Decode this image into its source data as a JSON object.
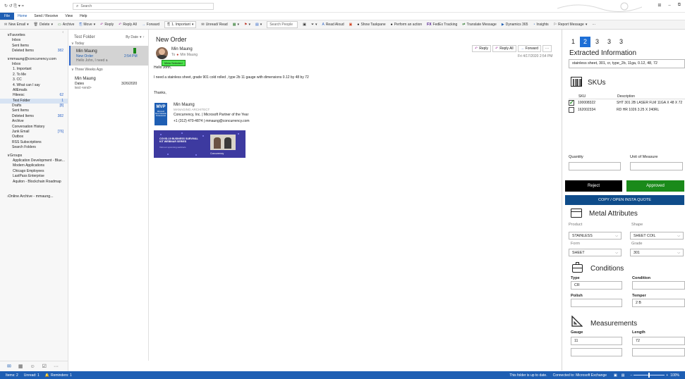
{
  "titlebar": {
    "search_placeholder": "Search",
    "qat": "↻ ↺ ⎘ ▾ ="
  },
  "menubar": {
    "tabs": [
      "File",
      "Home",
      "Send / Receive",
      "View",
      "Help"
    ],
    "active": "Home"
  },
  "toolbar": {
    "new_email": "New Email",
    "delete": "Delete",
    "archive": "Archive",
    "move": "Move",
    "reply": "Reply",
    "reply_all": "Reply All",
    "forward": "Forward",
    "category_tag": "1. Important",
    "unread_read": "Unread/ Read",
    "search_people": "Search People",
    "read_aloud": "Read Aloud",
    "show_taskpane": "Show Taskpane",
    "perform_action": "Perform an action",
    "fedex": "FedEx Tracking",
    "translate": "Translate Message",
    "dynamics": "Dynamics 365",
    "insights": "Insights",
    "report": "Report Message",
    "more": "···"
  },
  "leftnav": {
    "favorites_header": "Favorites",
    "favorites": [
      {
        "label": "Inbox",
        "count": ""
      },
      {
        "label": "Sent Items",
        "count": ""
      },
      {
        "label": "Deleted Items",
        "count": "382"
      }
    ],
    "account": "mmaung@concurrency.com",
    "folders": [
      {
        "label": "Inbox",
        "count": "",
        "level": 1
      },
      {
        "label": "1. Important",
        "count": "",
        "level": 2
      },
      {
        "label": "2. To Me",
        "count": "",
        "level": 2
      },
      {
        "label": "3. CC",
        "count": "",
        "level": 2
      },
      {
        "label": "4. What can I say",
        "count": "",
        "level": 2
      },
      {
        "label": "AllEmails",
        "count": "",
        "level": 2
      },
      {
        "label": "Hiteesc",
        "count": "62",
        "level": 2
      },
      {
        "label": "Test Folder",
        "count": "1",
        "level": 2,
        "selected": true
      },
      {
        "label": "Drafts",
        "count": "[8]",
        "level": 1
      },
      {
        "label": "Sent Items",
        "count": "",
        "level": 1
      },
      {
        "label": "Deleted Items",
        "count": "382",
        "level": 1
      },
      {
        "label": "Archive",
        "count": "",
        "level": 1
      },
      {
        "label": "Conversation History",
        "count": "",
        "level": 1
      },
      {
        "label": "Junk Email",
        "count": "[76]",
        "level": 1
      },
      {
        "label": "Outbox",
        "count": "",
        "level": 1
      },
      {
        "label": "RSS Subscriptions",
        "count": "",
        "level": 1
      },
      {
        "label": "Search Folders",
        "count": "",
        "level": 1
      }
    ],
    "groups_header": "Groups",
    "groups": [
      "Application Development - Blue...",
      "Modern Applications",
      "Chicago Employees",
      "LastPass Enterprise",
      "Aquiton - Blockchain Roadmap"
    ],
    "online_archive": "Online Archive - mmaung..."
  },
  "msglist": {
    "folder_title": "Test Folder",
    "sort_label": "By Date",
    "sort_arrow": "↑",
    "group_today": "Today",
    "group_older": "Three Weeks Ago",
    "messages": [
      {
        "from": "Min Maung",
        "subject": "New Order",
        "time": "2:54 PM",
        "preview": "Hello John,   I need a",
        "selected": true
      },
      {
        "from": "Min Maung",
        "subject": "Dates",
        "time": "3/26/2020",
        "preview": "test <end>",
        "selected": false
      }
    ]
  },
  "reading": {
    "subject": "New Order",
    "sender": "Min Maung",
    "to_label": "To",
    "to_name": "Min Maung",
    "date": "Fri 4/17/2020 2:54 PM",
    "actions": {
      "reply": "Reply",
      "reply_all": "Reply All",
      "forward": "Forward",
      "more": "···"
    },
    "tag": "Meta Selected",
    "body_greeting": "Hello John,",
    "body_text": "I need a stainless sheet, grade 901 cold rolled , type 2b 11 gauge with dimensions 0.12 by 48 by 72",
    "body_thanks": "Thanks,",
    "sig_name": "Min Maung",
    "sig_title": "MANAGING ARCHITECT",
    "sig_company": "Concurrency, Inc.  |  Microsoft Partner of the Year",
    "sig_contact": "+1 (312) 470-4874  |  mmaung@concurrency.com",
    "mvp_badge": "MVP",
    "mvp_sub": "Microsoft Most Valuable Professional",
    "banner_title": "COVID-19 BUSINESS SURVIVAL KIT WEBINAR SERIES",
    "banner_sub": "Visit our upcoming webinars",
    "banner_logo": "Concurrency"
  },
  "rpane": {
    "tabs": [
      "1",
      "2",
      "3",
      "3",
      "3"
    ],
    "active_tab": 1,
    "extracted_title": "Extracted Information",
    "extracted_text": "stainless sheet, 301, cr, type_2b, 11ga, 0.12, 48, 72",
    "skus_title": "SKUs",
    "sku_col": "SKU",
    "desc_col": "Description",
    "skus": [
      {
        "sku": "100008322",
        "desc": "SHT 301 2B LASER FLM 11GA X 48 X 72",
        "checked": true
      },
      {
        "sku": "162002334",
        "desc": "RD HR 1026 3.25 X 240RL",
        "checked": false
      }
    ],
    "quantity_label": "Quantity",
    "uom_label": "Unit of Measure",
    "quantity_value": "",
    "uom_value": "",
    "reject_label": "Reject",
    "approved_label": "Approved",
    "copy_label": "COPY / OPEN INSTA QUOTE",
    "metal_title": "Metal Attributes",
    "product_label": "Product",
    "product_value": "STAINLESS",
    "shape_label": "Shape",
    "shape_value": "SHEET COIL",
    "form_label": "Form",
    "form_value": "SHEET",
    "grade_label": "Grade",
    "grade_value": "301",
    "conditions_title": "Conditions",
    "type_label": "Type",
    "type_value": "CR",
    "condition_label": "Condition",
    "condition_value": "",
    "polish_label": "Polish",
    "polish_value": "",
    "temper_label": "Temper",
    "temper_value": "2 B",
    "measurements_title": "Measurements",
    "gauge_label": "Gauge",
    "gauge_value": "11",
    "length_label": "Length",
    "length_value": "72",
    "extra_value_1": "",
    "extra_value_2": "",
    "colors": {
      "accent": "#1e6fd6",
      "reject_bg": "#000000",
      "approved_bg": "#1a8a1a",
      "copy_bg": "#0f4c8a"
    }
  },
  "statusbar": {
    "items": "Items: 2",
    "unread": "Unread: 1",
    "reminders": "Reminders: 1",
    "folder_status": "This folder is up to date.",
    "connection": "Connected to: Microsoft Exchange",
    "zoom": "100%"
  }
}
